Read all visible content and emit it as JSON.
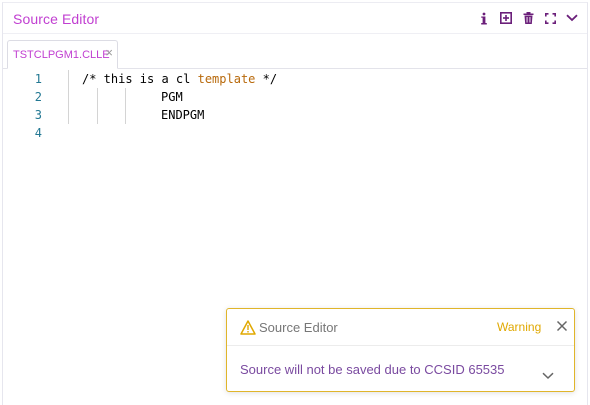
{
  "panel": {
    "title": "Source Editor",
    "icons": [
      "info-icon",
      "add-icon",
      "delete-icon",
      "fullscreen-icon",
      "collapse-chevron-icon"
    ]
  },
  "tabs": [
    {
      "label": "TSTCLPGM1.CLLE",
      "close_glyph": "×"
    }
  ],
  "editor": {
    "lines": [
      {
        "number": "1",
        "text": "/* this is a cl template */"
      },
      {
        "number": "2",
        "text": "PGM"
      },
      {
        "number": "3",
        "text": "ENDPGM"
      },
      {
        "number": "4",
        "text": ""
      }
    ]
  },
  "notification": {
    "title": "Source Editor",
    "severity": "Warning",
    "message": "Source will not be saved due to CCSID 65535",
    "close_glyph": "×"
  },
  "colors": {
    "accent": "#c13fd1",
    "warning": "#e0a800",
    "line_number": "#237893",
    "keyword": "#b8690b"
  }
}
